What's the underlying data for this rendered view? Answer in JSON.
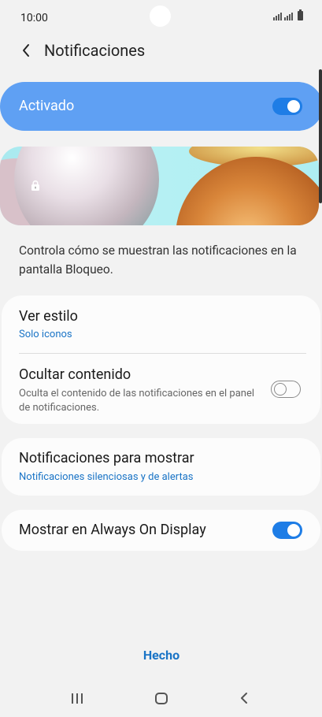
{
  "status_bar": {
    "time": "10:00"
  },
  "header": {
    "title": "Notificaciones"
  },
  "master_switch": {
    "label": "Activado",
    "on": true
  },
  "description": "Controla cómo se muestran las notificaciones en la pantalla Bloqueo.",
  "card1": {
    "view_style": {
      "title": "Ver estilo",
      "value": "Solo iconos"
    },
    "hide_content": {
      "title": "Ocultar contenido",
      "description": "Oculta el contenido de las notificaciones en el panel de notificaciones.",
      "on": false
    }
  },
  "card2": {
    "title": "Notificaciones para mostrar",
    "value": "Notificaciones silenciosas y de alertas"
  },
  "card3": {
    "title": "Mostrar en Always On Display",
    "on": true
  },
  "footer": {
    "done_label": "Hecho"
  },
  "colors": {
    "accent": "#1e7de6",
    "master_bg": "#5fa0f3",
    "link": "#1a74c6"
  },
  "icons": [
    "back-arrow-icon",
    "lock-icon",
    "recent-apps-icon",
    "home-icon",
    "nav-back-icon"
  ]
}
